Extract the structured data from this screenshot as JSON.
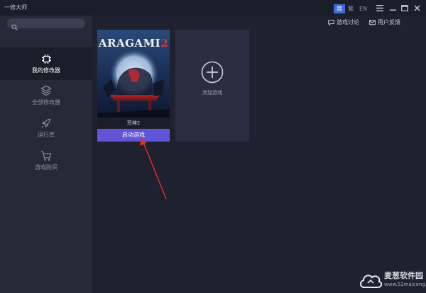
{
  "app": {
    "title": "一修大师"
  },
  "language": {
    "options": [
      "简",
      "繁",
      "EN"
    ],
    "selected": "简"
  },
  "search": {
    "placeholder": ""
  },
  "sidebar": {
    "items": [
      {
        "label": "我的修改器",
        "icon": "chip-icon",
        "active": true
      },
      {
        "label": "全部修改器",
        "icon": "layers-icon",
        "active": false
      },
      {
        "label": "运行库",
        "icon": "rocket-icon",
        "active": false
      },
      {
        "label": "游戏购买",
        "icon": "cart-icon",
        "active": false
      }
    ]
  },
  "header": {
    "discussion_label": "游戏讨论",
    "feedback_label": "用户反馈"
  },
  "games": [
    {
      "cover_title": "ARAGAMI",
      "cover_title_number": "2",
      "name": "荒神2",
      "start_label": "启动游戏"
    }
  ],
  "add_game": {
    "label": "添加游戏"
  },
  "watermark": {
    "text": "麦葱软件园",
    "url": "www.52maicong.com"
  },
  "colors": {
    "background": "#1f2130",
    "sidebar": "#262938",
    "card": "#2b2e40",
    "accent": "#5f55d6",
    "language_active": "#3f6bd6",
    "annotation_arrow": "#e0302c"
  }
}
